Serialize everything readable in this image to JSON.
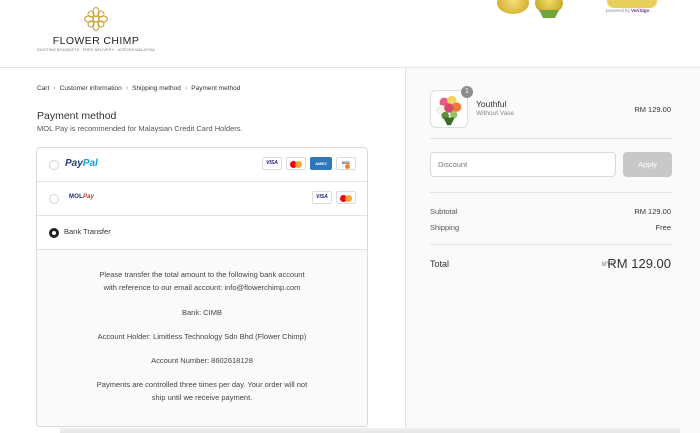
{
  "brand": {
    "name": "FLOWER CHIMP",
    "tagline": "EXCITING BOUQUETS · FREE DELIVERY · ACROSS MALAYSIA",
    "logo_icon": "flower-icon"
  },
  "trust_badges": {
    "verisign_prefix": "powered by",
    "verisign_name": "VeriSign"
  },
  "breadcrumb": {
    "items": [
      "Cart",
      "Customer information",
      "Shipping method",
      "Payment method"
    ]
  },
  "payment": {
    "title": "Payment method",
    "subtitle": "MOL Pay is recommended for Malaysian Credit Card Holders.",
    "options": [
      {
        "logo_pay": "Pay",
        "logo_pal": "Pal",
        "cards": [
          "VISA",
          "mastercard",
          "AMERICAN EXPRESS",
          "DISCOVER"
        ],
        "selected": false
      },
      {
        "logo_main": "MOL",
        "logo_accent": "Pay",
        "cards": [
          "VISA",
          "mastercard"
        ],
        "selected": false
      },
      {
        "label": "Bank Transfer",
        "selected": true
      }
    ],
    "bank_details": {
      "intro_line1": "Please transfer the total amount to the following bank account",
      "intro_line2": "with reference to our email account: info@flowerchimp.com",
      "bank": "Bank: CIMB",
      "holder": "Account Holder: Limitless Technology Sdn Bhd (Flower Chimp)",
      "account_number": "Account Number: 8602618128",
      "note_line1": "Payments are controlled three times per day. Your order will not",
      "note_line2": "ship until we receive payment."
    }
  },
  "order_summary": {
    "item": {
      "quantity": "1",
      "name": "Youthful",
      "variant": "Without Vase",
      "price": "RM 129.00"
    },
    "discount": {
      "placeholder": "Discount",
      "apply_label": "Apply"
    },
    "subtotal_label": "Subtotal",
    "subtotal_value": "RM 129.00",
    "shipping_label": "Shipping",
    "shipping_value": "Free",
    "total_label": "Total",
    "total_currency": "MYR",
    "total_value": "RM 129.00"
  }
}
